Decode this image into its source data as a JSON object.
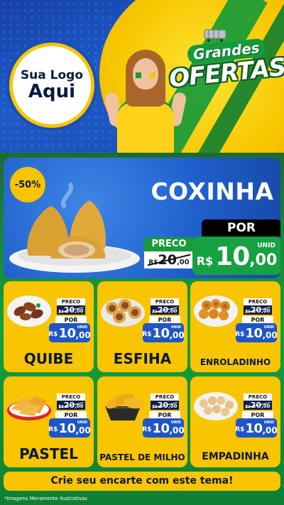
{
  "header": {
    "logo_line1": "Sua Logo",
    "logo_line2": "Aqui",
    "title_line1": "Grandes",
    "title_line2": "OFERTAS"
  },
  "featured": {
    "discount": "-50%",
    "name": "COXINHA",
    "preco_label": "PRECO",
    "por_label": "POR",
    "old_price": {
      "currency": "R$",
      "int": "20",
      "cents": ",00"
    },
    "new_price": {
      "currency": "R$",
      "int": "10",
      "cents": ",00",
      "unit": "UNID"
    }
  },
  "labels": {
    "preco": "PRECO",
    "por": "POR",
    "unid": "UNID",
    "currency": "R$"
  },
  "products": [
    {
      "name": "QUIBE",
      "old_int": "20",
      "old_cents": ",00",
      "new_int": "10",
      "new_cents": ",00"
    },
    {
      "name": "ESFIHA",
      "old_int": "20",
      "old_cents": ",00",
      "new_int": "10",
      "new_cents": ",00"
    },
    {
      "name": "ENROLADINHO",
      "old_int": "20",
      "old_cents": ",00",
      "new_int": "10",
      "new_cents": ",00"
    },
    {
      "name": "PASTEL",
      "old_int": "20",
      "old_cents": ",00",
      "new_int": "10",
      "new_cents": ",00"
    },
    {
      "name": "PASTEL DE MILHO",
      "old_int": "20",
      "old_cents": ",00",
      "new_int": "10",
      "new_cents": ",00"
    },
    {
      "name": "EMPADINHA",
      "old_int": "20",
      "old_cents": ",00",
      "new_int": "10",
      "new_cents": ",00"
    }
  ],
  "footer": {
    "cta": "Crie seu encarte com este tema!",
    "disclaimer": "*Imagens Meramente Ilustrativas"
  },
  "colors": {
    "blue": "#1f5fcc",
    "yellow": "#f9c400",
    "green": "#17a142",
    "navy": "#0a1a3d"
  }
}
